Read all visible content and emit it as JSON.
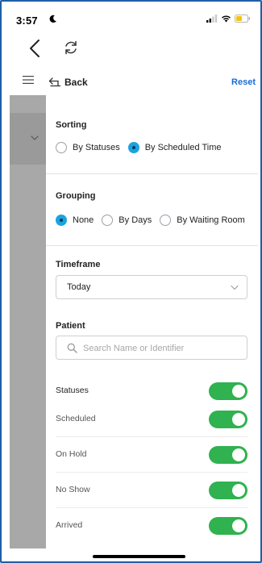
{
  "status_bar": {
    "time": "3:57",
    "icons": [
      "moon-icon",
      "signal-icon",
      "wifi-icon",
      "battery-icon"
    ],
    "battery_color": "#f2c40f"
  },
  "nav": {
    "icons": [
      "back-chevron-icon",
      "refresh-icon"
    ]
  },
  "header": {
    "back_label": "Back",
    "reset_label": "Reset",
    "menu_icon": "hamburger-icon",
    "back_icon": "back-arrow-icon"
  },
  "sorting": {
    "title": "Sorting",
    "options": [
      {
        "label": "By Statuses",
        "checked": false
      },
      {
        "label": "By Scheduled Time",
        "checked": true
      }
    ]
  },
  "grouping": {
    "title": "Grouping",
    "options": [
      {
        "label": "None",
        "checked": true
      },
      {
        "label": "By Days",
        "checked": false
      },
      {
        "label": "By Waiting Room",
        "checked": false
      }
    ]
  },
  "timeframe": {
    "title": "Timeframe",
    "selected": "Today"
  },
  "patient": {
    "title": "Patient",
    "search_placeholder": "Search Name or Identifier",
    "search_value": ""
  },
  "statuses": [
    {
      "label": "Statuses",
      "on": true
    },
    {
      "label": "Scheduled",
      "on": true
    },
    {
      "label": "On Hold",
      "on": true
    },
    {
      "label": "No Show",
      "on": true
    },
    {
      "label": "Arrived",
      "on": true
    }
  ],
  "colors": {
    "accent": "#1a6bd8",
    "radio_selected": "#1aa3e0",
    "toggle_on": "#2fb24f",
    "side_panel": "#a8a8a8"
  }
}
